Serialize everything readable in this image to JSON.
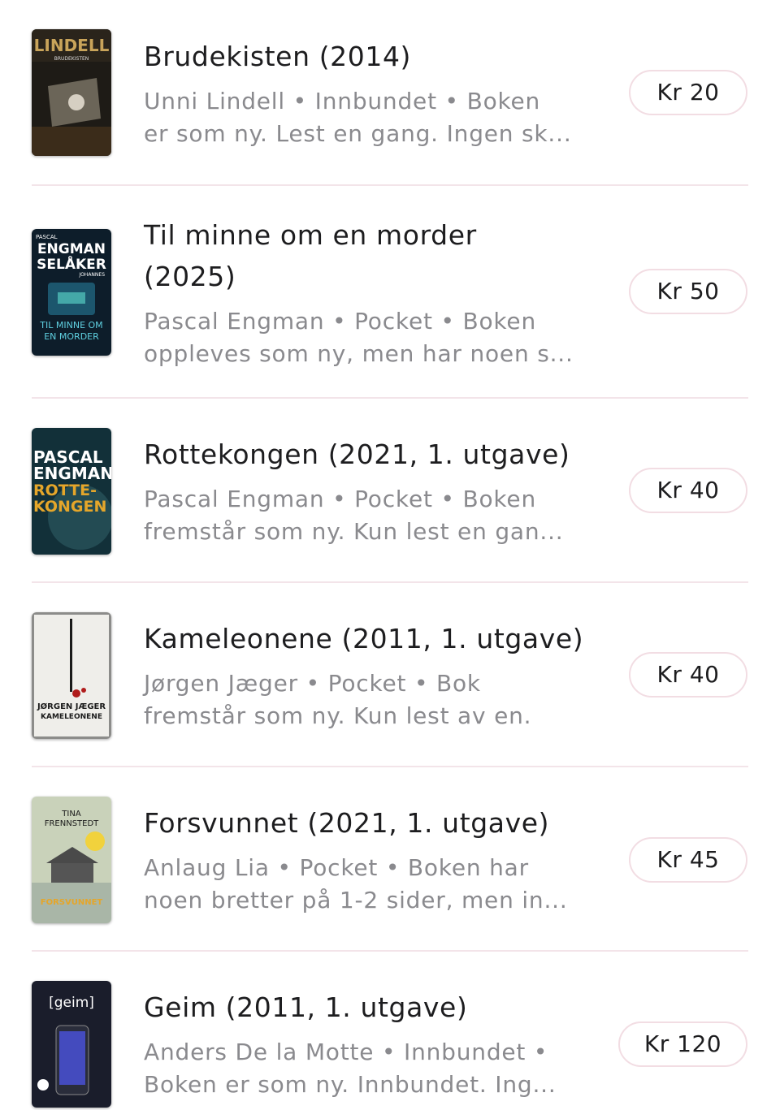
{
  "listings": [
    {
      "title_lines": [
        "Brudekisten (2014)"
      ],
      "desc_lines": [
        "Unni Lindell • Innbundet • Boken",
        "er som ny. Lest en gang. Ingen sk..."
      ],
      "price": "Kr 20",
      "cover": {
        "texts": [
          "LINDELL",
          "BRUDEKISTEN"
        ],
        "colors": {
          "bg": "#1e1b16",
          "accent": "#c9a45a"
        }
      }
    },
    {
      "title_lines": [
        "Til minne om en morder",
        "(2025)"
      ],
      "desc_lines": [
        "Pascal Engman • Pocket • Boken",
        "oppleves som ny, men har noen s..."
      ],
      "price": "Kr 50",
      "cover": {
        "texts": [
          "PASCAL",
          "ENGMAN",
          "SELÅKER",
          "JOHANNES",
          "TIL MINNE OM",
          "EN MORDER"
        ],
        "colors": {
          "bg": "#0d1d2a",
          "accent": "#2c8fb0"
        }
      }
    },
    {
      "title_lines": [
        "Rottekongen (2021, 1. utgave)"
      ],
      "desc_lines": [
        "Pascal Engman • Pocket • Boken",
        "fremstår som ny. Kun lest en gan..."
      ],
      "price": "Kr 40",
      "cover": {
        "texts": [
          "PASCAL",
          "ENGMAN",
          "ROTTE-",
          "KONGEN"
        ],
        "colors": {
          "bg": "#123039",
          "accent": "#e5a62a"
        }
      }
    },
    {
      "title_lines": [
        "Kameleonene (2011, 1. utgave)"
      ],
      "desc_lines": [
        "Jørgen Jæger • Pocket • Bok",
        "fremstår som ny. Kun lest av en."
      ],
      "price": "Kr 40",
      "cover": {
        "texts": [
          "JØRGEN JÆGER",
          "KAMELEONENE"
        ],
        "colors": {
          "bg": "#efeeea",
          "accent": "#b01c1c"
        }
      }
    },
    {
      "title_lines": [
        "Forsvunnet (2021, 1. utgave)"
      ],
      "desc_lines": [
        "Anlaug Lia • Pocket • Boken har",
        "noen bretter på 1-2 sider, men in..."
      ],
      "price": "Kr 45",
      "cover": {
        "texts": [
          "TINA",
          "FRENNSTEDT",
          "FORSVUNNET"
        ],
        "colors": {
          "bg": "#c9d2ba",
          "accent": "#e5a62a"
        }
      }
    },
    {
      "title_lines": [
        "Geim (2011, 1. utgave)"
      ],
      "desc_lines": [
        "Anders De la Motte • Innbundet •",
        "Boken er som ny. Innbundet. Ing..."
      ],
      "price": "Kr 120",
      "cover": {
        "texts": [
          "[geim]"
        ],
        "colors": {
          "bg": "#1a1d2b",
          "accent": "#4b53e0"
        }
      }
    }
  ]
}
